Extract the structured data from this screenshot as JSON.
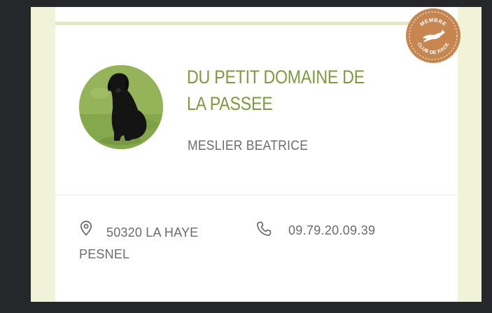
{
  "listing": {
    "kennel_name": "DU PETIT DOMAINE DE LA PASSEE",
    "owner": "MESLIER BEATRICE",
    "address": "50320 LA HAYE PESNEL",
    "phone": "09.79.20.09.39"
  },
  "badge": {
    "line_top": "MEMBRE",
    "line_bottom": "CLUB DE RACE"
  },
  "icons": {
    "location": "map-pin-icon",
    "phone": "phone-icon",
    "badge_emblem": "running-dog-icon"
  },
  "colors": {
    "accent_green": "#7d9a3f",
    "badge_brown": "#c7864f",
    "frame_cream": "#f1f3d8",
    "text_gray": "#6b6b6b"
  }
}
